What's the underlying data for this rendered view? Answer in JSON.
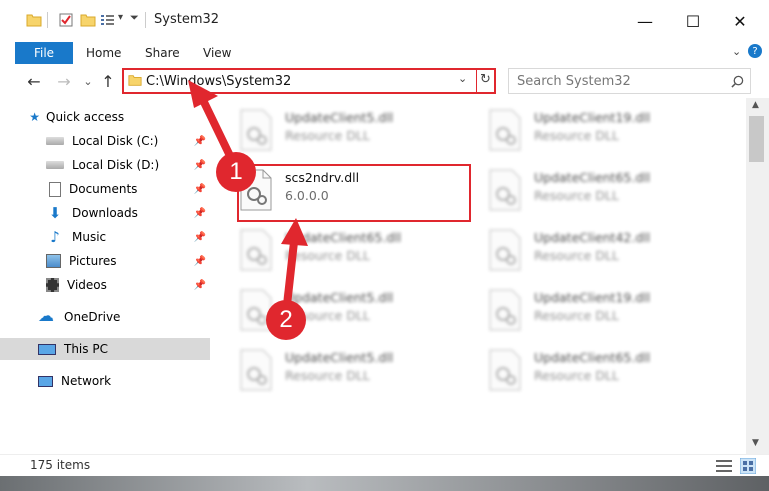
{
  "window": {
    "title": "System32",
    "minimize_glyph": "—",
    "maximize_glyph": "☐",
    "close_glyph": "✕"
  },
  "ribbon": {
    "tabs": [
      "File",
      "Home",
      "Share",
      "View"
    ],
    "help_glyph": "?"
  },
  "nav": {
    "back_glyph": "←",
    "forward_glyph": "→",
    "recent_glyph": "⌄",
    "up_glyph": "↑",
    "address": "C:\\Windows\\System32",
    "search_placeholder": "Search System32"
  },
  "sidebar": {
    "items": [
      {
        "label": "Quick access"
      },
      {
        "label": "Local Disk (C:)"
      },
      {
        "label": "Local Disk (D:)"
      },
      {
        "label": "Documents"
      },
      {
        "label": "Downloads"
      },
      {
        "label": "Music"
      },
      {
        "label": "Pictures"
      },
      {
        "label": "Videos"
      },
      {
        "label": "OneDrive"
      },
      {
        "label": "This PC"
      },
      {
        "label": "Network"
      }
    ]
  },
  "files": [
    {
      "name": "UpdateClient5.dll",
      "type": "Resource DLL"
    },
    {
      "name": "UpdateClient19.dll",
      "type": "Resource DLL"
    },
    {
      "name": "scs2ndrv.dll",
      "type": "6.0.0.0"
    },
    {
      "name": "UpdateClient65.dll",
      "type": "Resource DLL"
    },
    {
      "name": "UpdateClient65.dll",
      "type": "Resource DLL"
    },
    {
      "name": "UpdateClient42.dll",
      "type": "Resource DLL"
    },
    {
      "name": "UpdateClient5.dll",
      "type": "Resource DLL"
    },
    {
      "name": "UpdateClient19.dll",
      "type": "Resource DLL"
    },
    {
      "name": "UpdateClient5.dll",
      "type": "Resource DLL"
    },
    {
      "name": "UpdateClient65.dll",
      "type": "Resource DLL"
    }
  ],
  "status": {
    "item_count": "175 items"
  },
  "annotations": {
    "step1": "1",
    "step2": "2",
    "color": "#e0272e"
  }
}
